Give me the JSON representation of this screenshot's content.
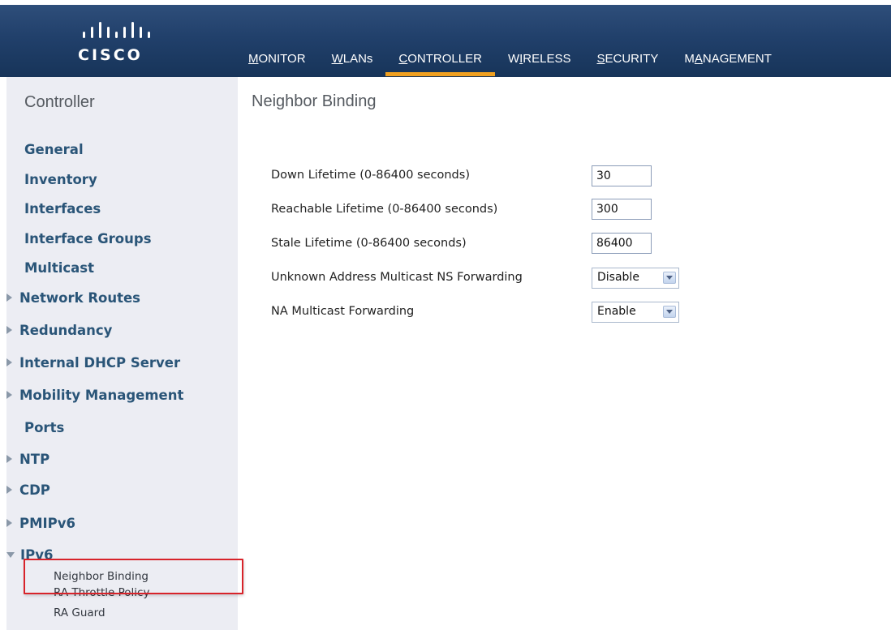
{
  "brand": {
    "logo_text": "CISCO",
    "header_color": "#21406b",
    "active_accent": "#f0a020"
  },
  "nav": {
    "items": [
      {
        "first": "M",
        "rest": "ONITOR",
        "active": false
      },
      {
        "first": "W",
        "rest": "LANs",
        "active": false
      },
      {
        "first": "C",
        "rest": "ONTROLLER",
        "active": true
      },
      {
        "first": "W",
        "rest": "IRELESS",
        "active": false
      },
      {
        "first": "S",
        "rest": "ECURITY",
        "active": false
      },
      {
        "first": "M",
        "rest": "ANAGEMENT",
        "active": false
      }
    ]
  },
  "sidebar": {
    "title": "Controller",
    "items": [
      {
        "label": "General",
        "expandable": false
      },
      {
        "label": "Inventory",
        "expandable": false
      },
      {
        "label": "Interfaces",
        "expandable": false
      },
      {
        "label": "Interface Groups",
        "expandable": false
      },
      {
        "label": "Multicast",
        "expandable": false
      },
      {
        "label": "Network Routes",
        "expandable": true
      },
      {
        "label": "Redundancy",
        "expandable": true
      },
      {
        "label": "Internal DHCP Server",
        "expandable": true
      },
      {
        "label": "Mobility Management",
        "expandable": true
      },
      {
        "label": "Ports",
        "expandable": false
      },
      {
        "label": "NTP",
        "expandable": true
      },
      {
        "label": "CDP",
        "expandable": true
      },
      {
        "label": "PMIPv6",
        "expandable": true
      },
      {
        "label": "IPv6",
        "expandable": true,
        "expanded": true
      }
    ],
    "subitems": [
      {
        "label": "Neighbor Binding",
        "selected": true
      },
      {
        "label": "RA Throttle Policy"
      },
      {
        "label": "RA Guard"
      }
    ]
  },
  "main": {
    "title": "Neighbor Binding",
    "fields": [
      {
        "label": "Down Lifetime (0-86400 seconds)",
        "type": "text",
        "value": "30"
      },
      {
        "label": "Reachable Lifetime (0-86400 seconds)",
        "type": "text",
        "value": "300"
      },
      {
        "label": "Stale Lifetime (0-86400 seconds)",
        "type": "text",
        "value": "86400"
      },
      {
        "label": "Unknown Address Multicast NS Forwarding",
        "type": "select",
        "value": "Disable"
      },
      {
        "label": "NA Multicast Forwarding",
        "type": "select",
        "value": "Enable"
      }
    ]
  },
  "annotation": {
    "highlight_color": "#d8232a"
  }
}
